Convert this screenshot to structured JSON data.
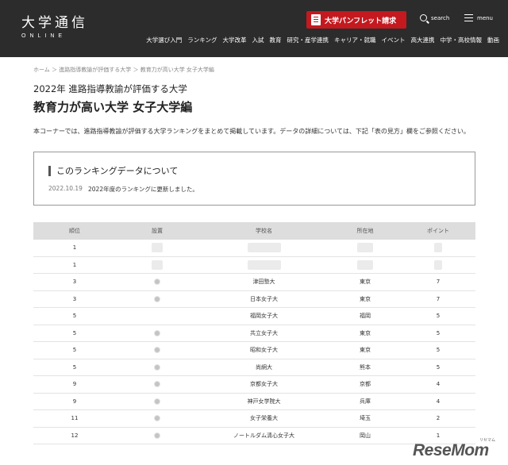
{
  "header": {
    "logo_main": "大学通信",
    "logo_sub": "ONLINE",
    "pamphlet_label": "大学パンフレット請求",
    "search_label": "search",
    "menu_label": "menu",
    "nav": [
      "大学選び入門",
      "ランキング",
      "大学改革",
      "入試",
      "教育",
      "研究・産学連携",
      "キャリア・就職",
      "イベント",
      "高大連携",
      "中学・高校情報",
      "動画"
    ]
  },
  "breadcrumb": "ホーム ＞ 進路指導教諭が評価する大学 ＞ 教育力が高い大学 女子大学編",
  "subtitle": "2022年 進路指導教諭が評価する大学",
  "title": "教育力が高い大学 女子大学編",
  "intro": "本コーナーでは、進路指導教諭が評価する大学ランキングをまとめて掲載しています。データの詳細については、下記「表の見方」欄をご参照ください。",
  "infobox": {
    "heading": "このランキングデータについて",
    "date": "2022.10.19",
    "note": "2022年度のランキングに更新しました。"
  },
  "table": {
    "headers": [
      "順位",
      "設置",
      "学校名",
      "所在地",
      "ポイント"
    ],
    "rows": [
      {
        "rank": "1",
        "badge": false,
        "name": "",
        "location": "",
        "points": "",
        "blurred": true
      },
      {
        "rank": "1",
        "badge": false,
        "name": "",
        "location": "",
        "points": "",
        "blurred": true
      },
      {
        "rank": "3",
        "badge": true,
        "name": "津田塾大",
        "location": "東京",
        "points": "7",
        "blurred": false
      },
      {
        "rank": "3",
        "badge": true,
        "name": "日本女子大",
        "location": "東京",
        "points": "7",
        "blurred": false
      },
      {
        "rank": "5",
        "badge": false,
        "name": "福岡女子大",
        "location": "福岡",
        "points": "5",
        "blurred": false
      },
      {
        "rank": "5",
        "badge": true,
        "name": "共立女子大",
        "location": "東京",
        "points": "5",
        "blurred": false
      },
      {
        "rank": "5",
        "badge": true,
        "name": "昭和女子大",
        "location": "東京",
        "points": "5",
        "blurred": false
      },
      {
        "rank": "5",
        "badge": true,
        "name": "尚絅大",
        "location": "熊本",
        "points": "5",
        "blurred": false
      },
      {
        "rank": "9",
        "badge": true,
        "name": "京都女子大",
        "location": "京都",
        "points": "4",
        "blurred": false
      },
      {
        "rank": "9",
        "badge": true,
        "name": "神戸女学院大",
        "location": "兵庫",
        "points": "4",
        "blurred": false
      },
      {
        "rank": "11",
        "badge": true,
        "name": "女子栄養大",
        "location": "埼玉",
        "points": "2",
        "blurred": false
      },
      {
        "rank": "12",
        "badge": true,
        "name": "ノートルダム清心女子大",
        "location": "岡山",
        "points": "1",
        "blurred": false
      }
    ]
  },
  "watermark": "ReseMom",
  "watermark_sub": "リセマム"
}
